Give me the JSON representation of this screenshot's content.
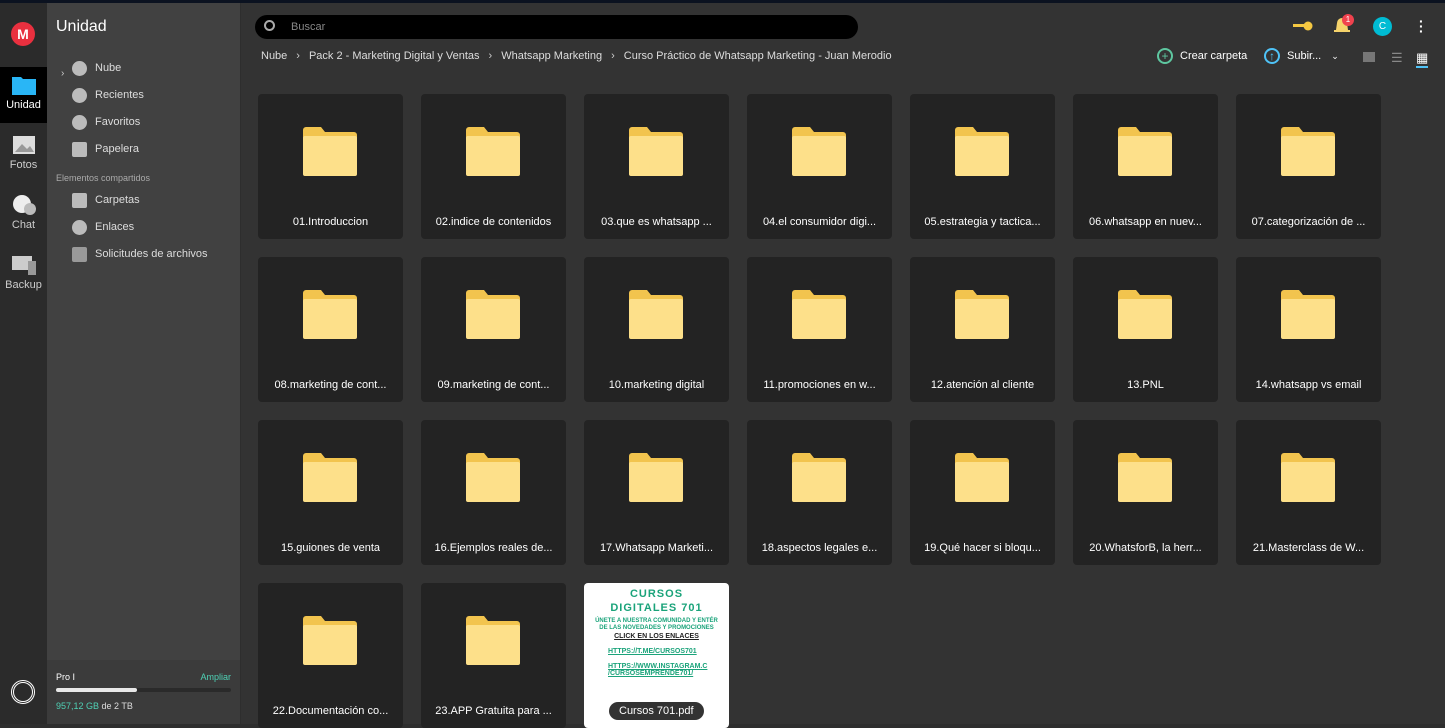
{
  "rail": {
    "logo": "M",
    "items": [
      {
        "label": "Unidad",
        "icon": "folder-icon"
      },
      {
        "label": "Fotos",
        "icon": "photo-icon"
      },
      {
        "label": "Chat",
        "icon": "chat-icon"
      },
      {
        "label": "Backup",
        "icon": "backup-icon"
      }
    ]
  },
  "sidebar": {
    "title": "Unidad",
    "items": [
      {
        "label": "Nube",
        "icon": "cloud-icon"
      },
      {
        "label": "Recientes",
        "icon": "clock-icon"
      },
      {
        "label": "Favoritos",
        "icon": "heart-icon"
      },
      {
        "label": "Papelera",
        "icon": "trash-icon"
      }
    ],
    "shared_title": "Elementos compartidos",
    "shared": [
      {
        "label": "Carpetas",
        "icon": "shared-folder-icon"
      },
      {
        "label": "Enlaces",
        "icon": "link-icon"
      },
      {
        "label": "Solicitudes de archivos",
        "icon": "file-request-icon"
      }
    ],
    "storage": {
      "plan": "Pro I",
      "upgrade": "Ampliar",
      "used": "957,12 GB",
      "of": "de 2 TB",
      "fraction": 0.47
    }
  },
  "search": {
    "placeholder": "Buscar"
  },
  "header": {
    "notifications": "1",
    "avatar": "C"
  },
  "breadcrumb": [
    "Nube",
    "Pack 2 - Marketing Digital y Ventas",
    "Whatsapp Marketing",
    "Curso Práctico de Whatsapp Marketing - Juan Merodio"
  ],
  "toolbar": {
    "create_folder": "Crear carpeta",
    "upload": "Subir..."
  },
  "colors": {
    "accent": "#4fd1b5",
    "folder": "#fbdc81",
    "bell": "#f5d36b",
    "avatar": "#00bcd4",
    "logo": "#e9303f"
  },
  "folders": [
    "01.Introduccion",
    "02.indice de contenidos",
    "03.que es whatsapp ...",
    "04.el consumidor digi...",
    "05.estrategia y tactica...",
    "06.whatsapp en nuev...",
    "07.categorización de ...",
    "08.marketing de cont...",
    "09.marketing de cont...",
    "10.marketing digital",
    "11.promociones en w...",
    "12.atención al cliente",
    "13.PNL",
    "14.whatsapp vs email",
    "15.guiones de venta",
    "16.Ejemplos reales de...",
    "17.Whatsapp Marketi...",
    "18.aspectos legales e...",
    "19.Qué hacer si bloqu...",
    "20.WhatsforB, la herr...",
    "21.Masterclass de W...",
    "22.Documentación co...",
    "23.APP Gratuita para ..."
  ],
  "file": {
    "name": "Cursos 701.pdf",
    "preview": {
      "title1": "CURSOS",
      "title2": "DIGITALES 701",
      "line1": "ÚNETE A NUESTRA COMUNIDAD Y ENTÉR",
      "line2": "DE LAS NOVEDADES Y PROMOCIONES",
      "cta": "CLICK EN LOS ENLACES",
      "link1": "HTTPS://T.ME/CURSOS701",
      "link2": "HTTPS://WWW.INSTAGRAM.C /CURSOSEMPRENDE701/"
    }
  }
}
